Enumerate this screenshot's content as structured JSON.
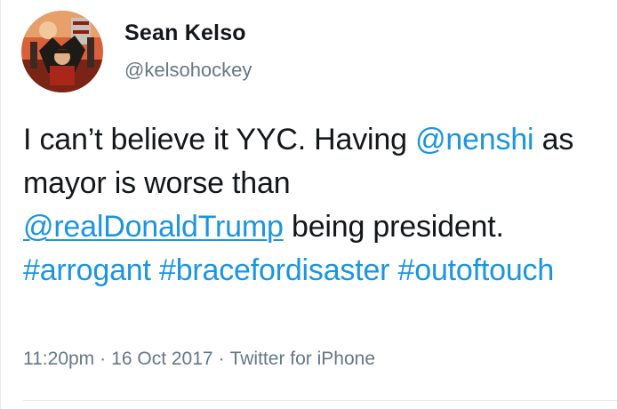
{
  "user": {
    "display_name": "Sean Kelso",
    "screen_name": "@kelsohockey"
  },
  "tweet": {
    "segments": [
      {
        "text": "I can’t believe it YYC.  Having ",
        "type": "text"
      },
      {
        "text": "@nenshi",
        "type": "mention"
      },
      {
        "text": " as mayor is worse than ",
        "type": "text"
      },
      {
        "text": "@realDonaldTrump",
        "type": "mention"
      },
      {
        "text": " being president. ",
        "type": "text"
      },
      {
        "text": "#arrogant",
        "type": "hashtag"
      },
      {
        "text": " ",
        "type": "text"
      },
      {
        "text": "#bracefordisaster",
        "type": "hashtag"
      },
      {
        "text": " ",
        "type": "text"
      },
      {
        "text": "#outoftouch",
        "type": "hashtag"
      }
    ]
  },
  "meta": {
    "time": "11:20pm",
    "date": "16 Oct 2017",
    "source": "Twitter for iPhone",
    "separator": "·"
  },
  "colors": {
    "link": "#1b95e0",
    "text": "#14171a",
    "secondary": "#657786"
  },
  "icons": {
    "avatar": "profile-photo"
  }
}
